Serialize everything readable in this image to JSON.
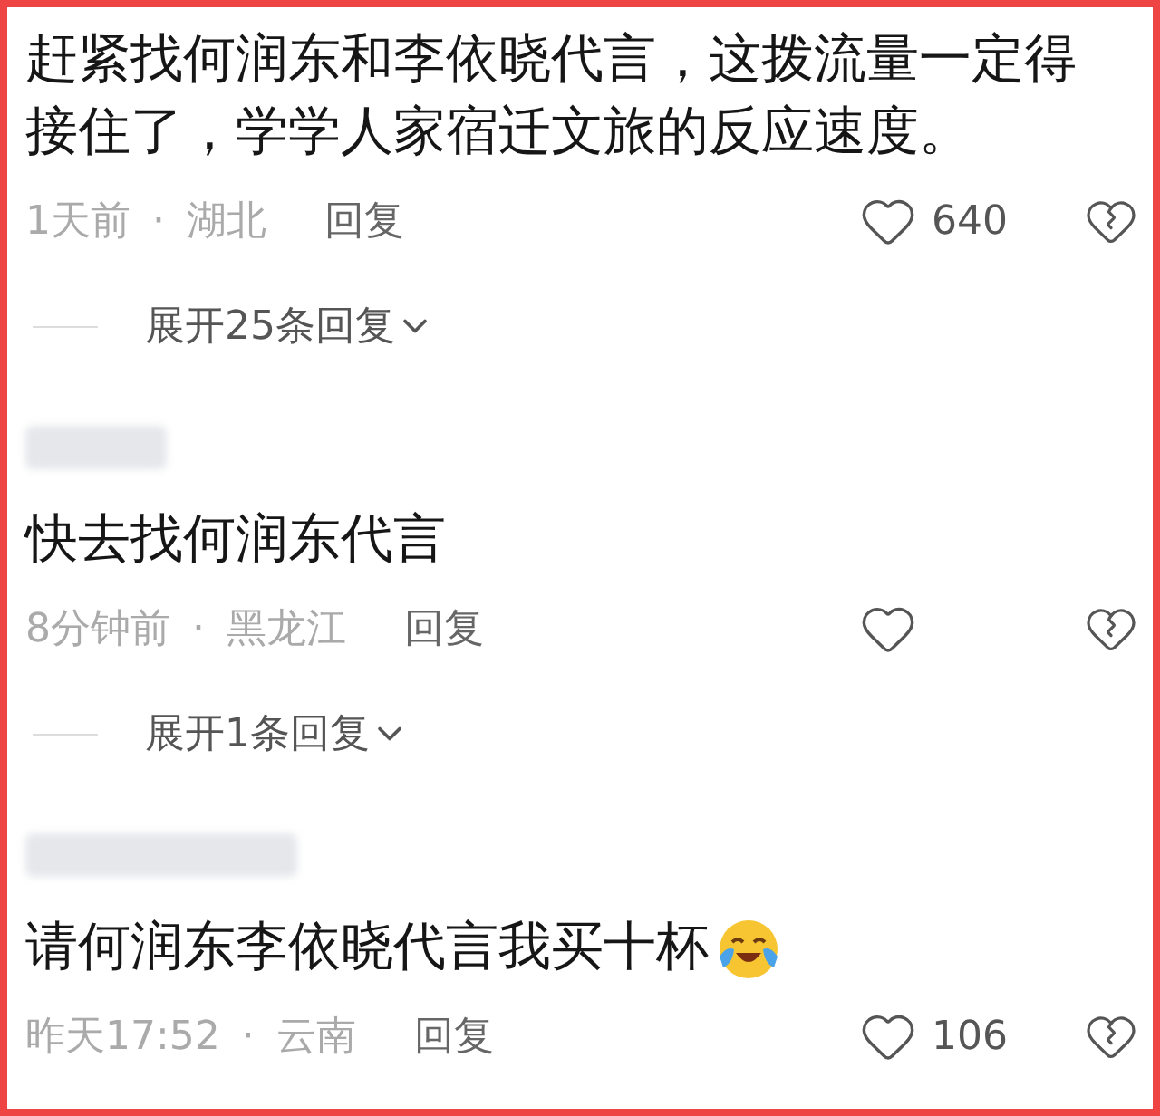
{
  "comments": [
    {
      "username_hidden": false,
      "text": "赶紧找何润东和李依晓代言，这拨流量一定得接住了，学学人家宿迁文旅的反应速度。",
      "trailing_emoji": false,
      "time": "1天前",
      "separator": "·",
      "location": "湖北",
      "reply_label": "回复",
      "likes": "640",
      "expand_label": "展开25条回复"
    },
    {
      "username_hidden": true,
      "text": "快去找何润东代言",
      "trailing_emoji": false,
      "time": "8分钟前",
      "separator": "·",
      "location": "黑龙江",
      "reply_label": "回复",
      "expand_label": "展开1条回复"
    },
    {
      "username_hidden": true,
      "text": "请何润东李依晓代言我买十杯",
      "trailing_emoji": true,
      "time": "昨天17:52",
      "separator": "·",
      "location": "云南",
      "reply_label": "回复",
      "likes": "106"
    }
  ]
}
